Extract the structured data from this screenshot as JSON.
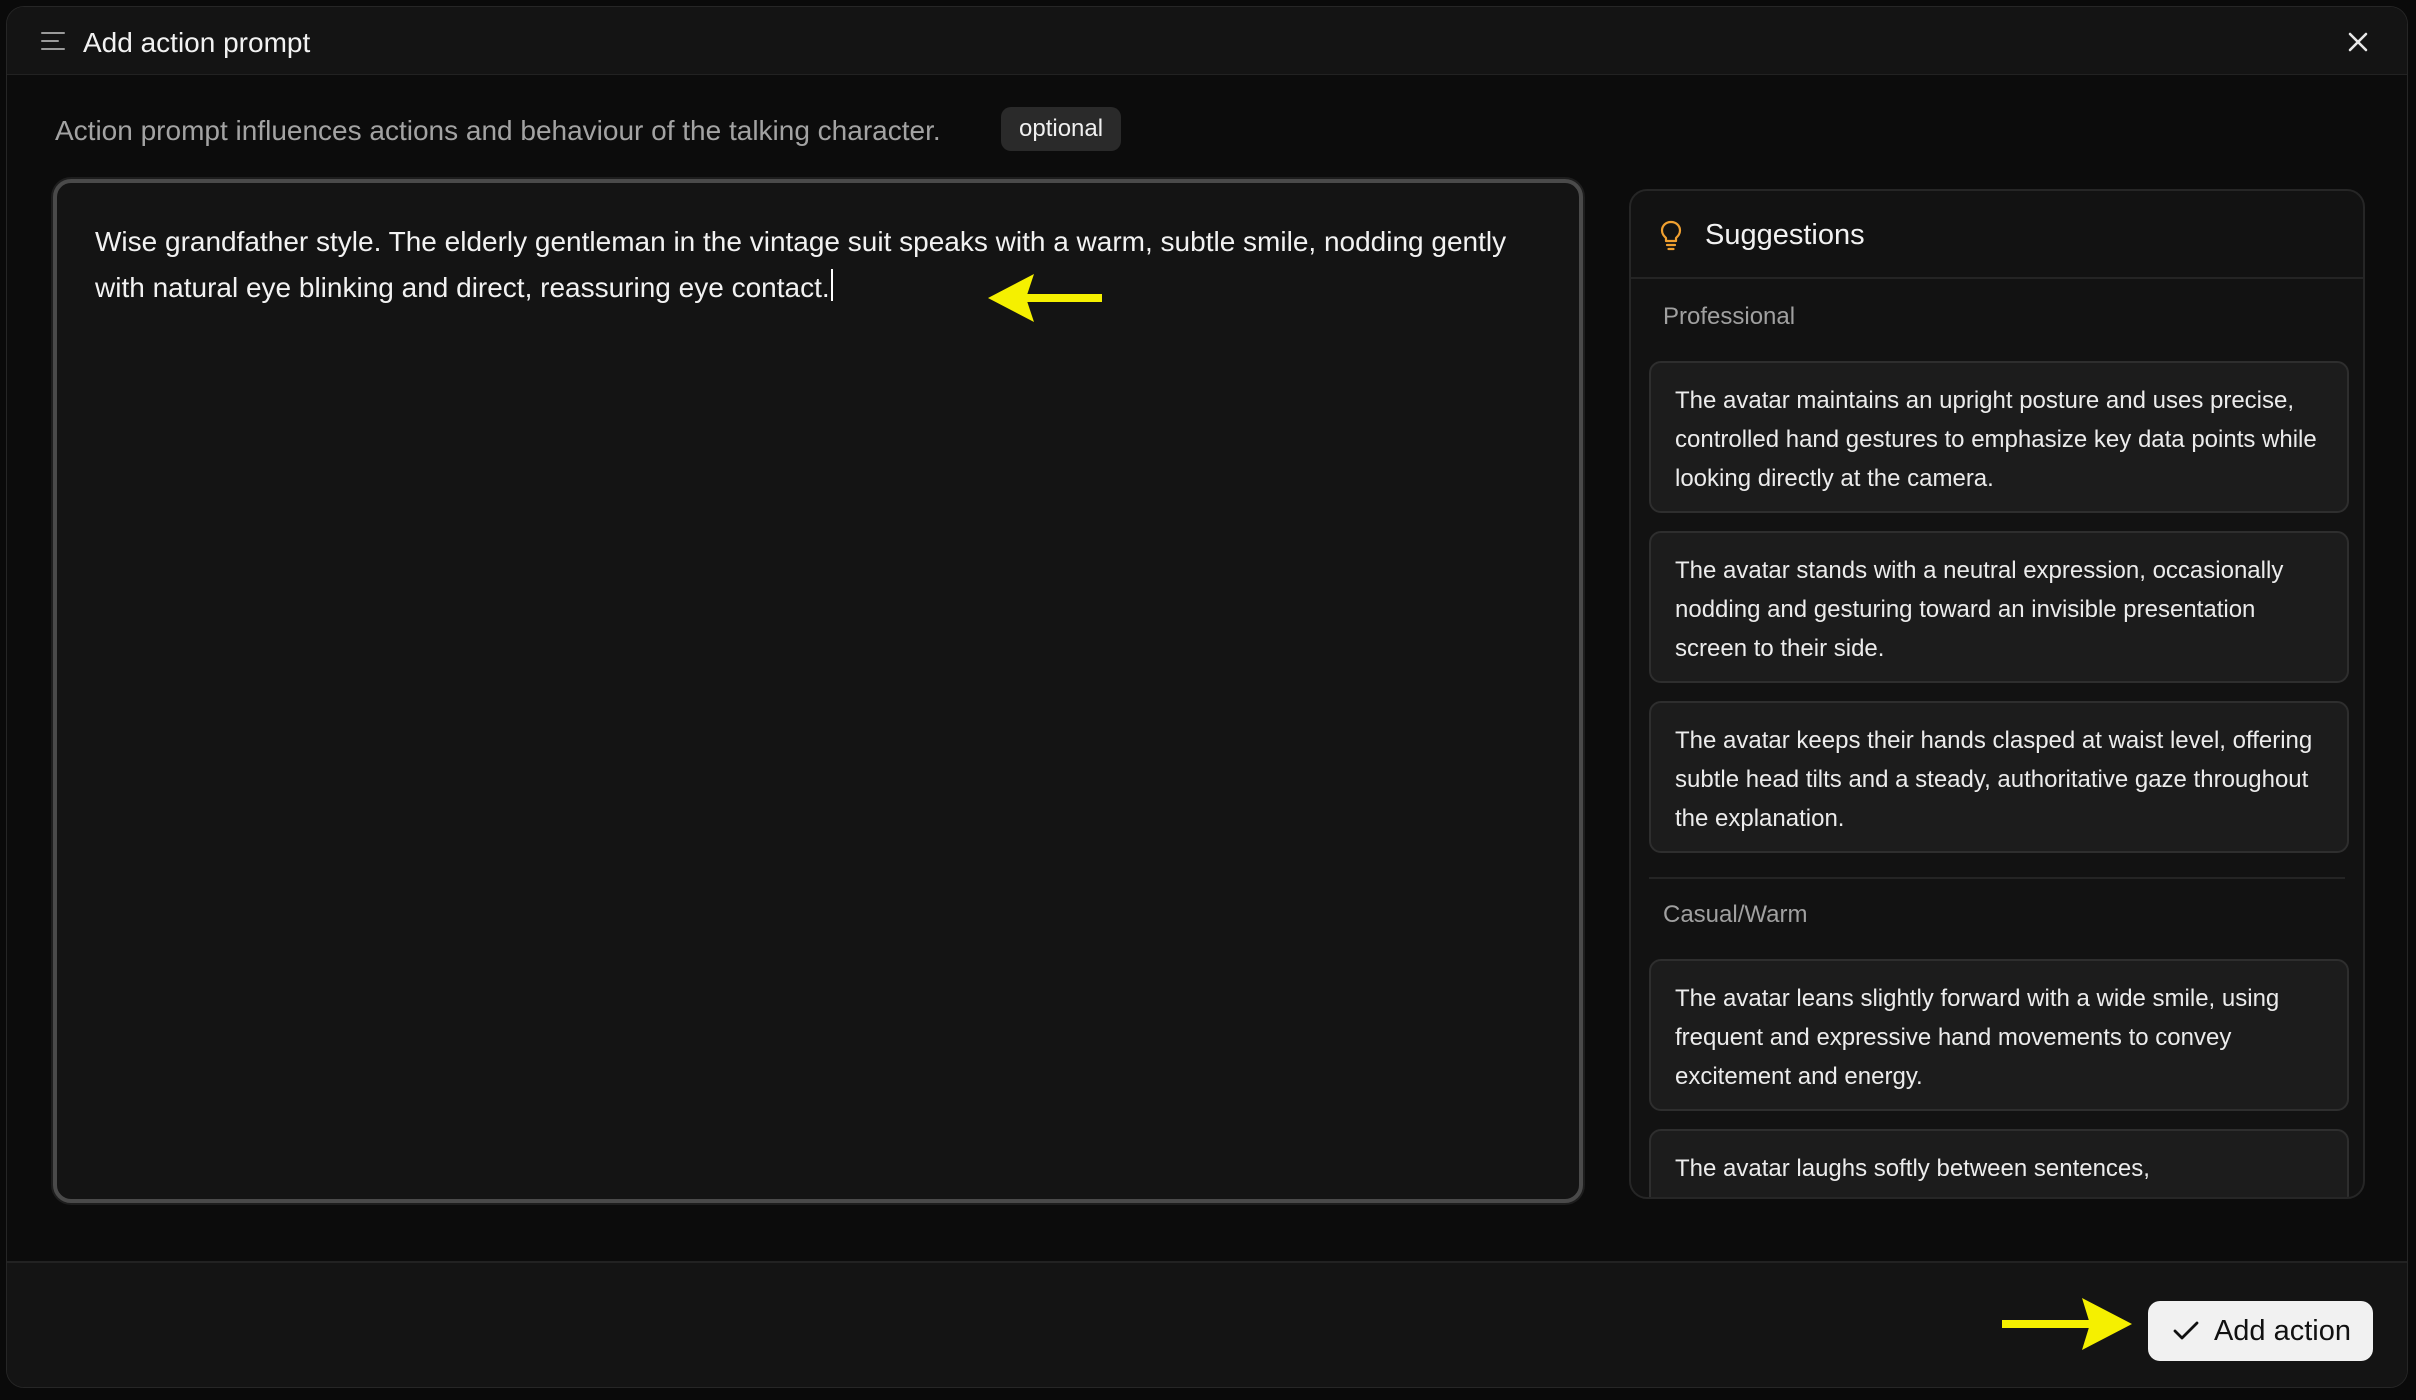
{
  "header": {
    "title": "Add action prompt"
  },
  "intro": {
    "description": "Action prompt influences actions and behaviour of the talking character.",
    "badge": "optional"
  },
  "editor": {
    "value": "Wise grandfather style. The elderly gentleman in the vintage suit speaks with a warm, subtle smile, nodding gently with natural eye blinking and direct, reassuring eye contact."
  },
  "suggestions": {
    "title": "Suggestions",
    "groups": [
      {
        "label": "Professional",
        "items": [
          "The avatar maintains an upright posture and uses precise, controlled hand gestures to emphasize key data points while looking directly at the camera.",
          "The avatar stands with a neutral expression, occasionally nodding and gesturing toward an invisible presentation screen to their side.",
          "The avatar keeps their hands clasped at waist level, offering subtle head tilts and a steady, authoritative gaze throughout the explanation."
        ]
      },
      {
        "label": "Casual/Warm",
        "items": [
          "The avatar leans slightly forward with a wide smile, using frequent and expressive hand movements to convey excitement and energy.",
          "The avatar laughs softly between sentences,"
        ]
      }
    ]
  },
  "footer": {
    "add_label": "Add action"
  },
  "colors": {
    "accent_arrow": "#f5f000",
    "bulb": "#f0a030",
    "button_bg": "#f1f1f1"
  }
}
